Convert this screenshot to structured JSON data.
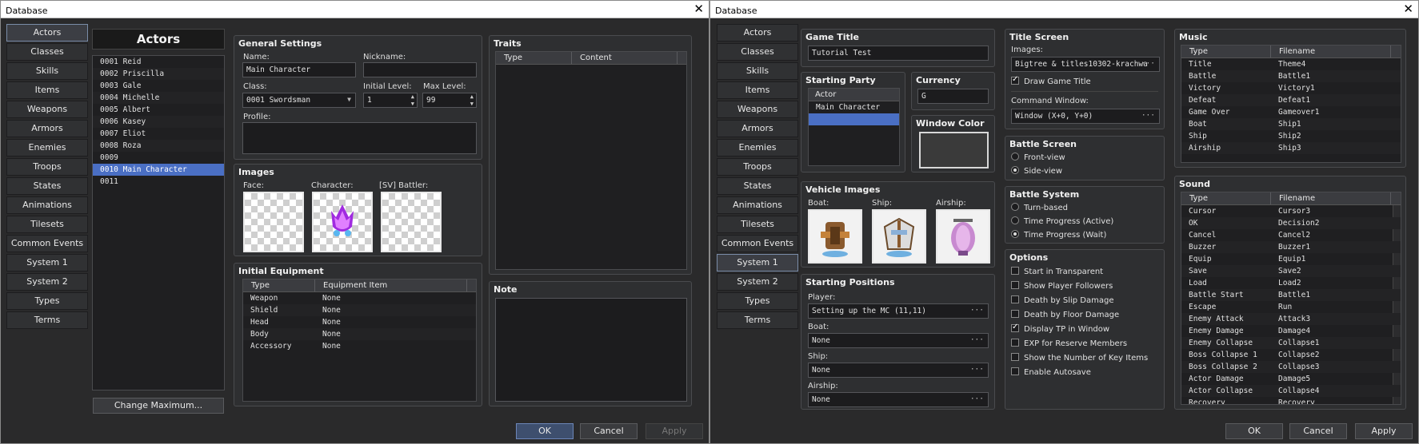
{
  "left": {
    "window_title": "Database",
    "tabs": [
      "Actors",
      "Classes",
      "Skills",
      "Items",
      "Weapons",
      "Armors",
      "Enemies",
      "Troops",
      "States",
      "Animations",
      "Tilesets",
      "Common Events",
      "System 1",
      "System 2",
      "Types",
      "Terms"
    ],
    "list_title": "Actors",
    "actors": [
      "0001 Reid",
      "0002 Priscilla",
      "0003 Gale",
      "0004 Michelle",
      "0005 Albert",
      "0006 Kasey",
      "0007 Eliot",
      "0008 Roza",
      "0009",
      "0010 Main Character",
      "0011"
    ],
    "change_max": "Change Maximum...",
    "general": {
      "title": "General Settings",
      "name_label": "Name:",
      "name_value": "Main Character",
      "nick_label": "Nickname:",
      "nick_value": "",
      "class_label": "Class:",
      "class_value": "0001 Swordsman",
      "init_label": "Initial Level:",
      "init_value": "1",
      "max_label": "Max Level:",
      "max_value": "99",
      "profile_label": "Profile:"
    },
    "images": {
      "title": "Images",
      "face": "Face:",
      "character": "Character:",
      "battler": "[SV] Battler:"
    },
    "equipment": {
      "title": "Initial Equipment",
      "col_type": "Type",
      "col_item": "Equipment Item",
      "rows": [
        [
          "Weapon",
          "None"
        ],
        [
          "Shield",
          "None"
        ],
        [
          "Head",
          "None"
        ],
        [
          "Body",
          "None"
        ],
        [
          "Accessory",
          "None"
        ]
      ]
    },
    "traits": {
      "title": "Traits",
      "col_type": "Type",
      "col_content": "Content"
    },
    "note": {
      "title": "Note"
    },
    "buttons": {
      "ok": "OK",
      "cancel": "Cancel",
      "apply": "Apply"
    }
  },
  "right": {
    "window_title": "Database",
    "tabs": [
      "Actors",
      "Classes",
      "Skills",
      "Items",
      "Weapons",
      "Armors",
      "Enemies",
      "Troops",
      "States",
      "Animations",
      "Tilesets",
      "Common Events",
      "System 1",
      "System 2",
      "Types",
      "Terms"
    ],
    "game_title": {
      "title": "Game Title",
      "value": "Tutorial Test"
    },
    "party": {
      "title": "Starting Party",
      "header": "Actor",
      "rows": [
        "Main Character"
      ]
    },
    "currency": {
      "title": "Currency",
      "value": "G"
    },
    "window_color": {
      "title": "Window Color"
    },
    "vehicle": {
      "title": "Vehicle Images",
      "boat": "Boat:",
      "ship": "Ship:",
      "airship": "Airship:"
    },
    "positions": {
      "title": "Starting Positions",
      "player_label": "Player:",
      "player_value": "Setting up the MC (11,11)",
      "boat_label": "Boat:",
      "boat_value": "None",
      "ship_label": "Ship:",
      "ship_value": "None",
      "airship_label": "Airship:",
      "airship_value": "None"
    },
    "title_screen": {
      "title": "Title Screen",
      "images_label": "Images:",
      "images_value": "Bigtree & titles10302-krachwa",
      "draw_title": "Draw Game Title",
      "cmd_label": "Command Window:",
      "cmd_value": "Window (X+0, Y+0)"
    },
    "battle_screen": {
      "title": "Battle Screen",
      "front": "Front-view",
      "side": "Side-view"
    },
    "battle_system": {
      "title": "Battle System",
      "opts": [
        "Turn-based",
        "Time Progress (Active)",
        "Time Progress (Wait)"
      ]
    },
    "options": {
      "title": "Options",
      "items": [
        "Start in Transparent",
        "Show Player Followers",
        "Death by Slip Damage",
        "Death by Floor Damage",
        "Display TP in Window",
        "EXP for Reserve Members",
        "Show the Number of Key Items",
        "Enable Autosave"
      ]
    },
    "music": {
      "title": "Music",
      "col_type": "Type",
      "col_file": "Filename",
      "rows": [
        [
          "Title",
          "Theme4"
        ],
        [
          "Battle",
          "Battle1"
        ],
        [
          "Victory",
          "Victory1"
        ],
        [
          "Defeat",
          "Defeat1"
        ],
        [
          "Game Over",
          "Gameover1"
        ],
        [
          "Boat",
          "Ship1"
        ],
        [
          "Ship",
          "Ship2"
        ],
        [
          "Airship",
          "Ship3"
        ]
      ]
    },
    "sound": {
      "title": "Sound",
      "col_type": "Type",
      "col_file": "Filename",
      "rows": [
        [
          "Cursor",
          "Cursor3"
        ],
        [
          "OK",
          "Decision2"
        ],
        [
          "Cancel",
          "Cancel2"
        ],
        [
          "Buzzer",
          "Buzzer1"
        ],
        [
          "Equip",
          "Equip1"
        ],
        [
          "Save",
          "Save2"
        ],
        [
          "Load",
          "Load2"
        ],
        [
          "Battle Start",
          "Battle1"
        ],
        [
          "Escape",
          "Run"
        ],
        [
          "Enemy Attack",
          "Attack3"
        ],
        [
          "Enemy Damage",
          "Damage4"
        ],
        [
          "Enemy Collapse",
          "Collapse1"
        ],
        [
          "Boss Collapse 1",
          "Collapse2"
        ],
        [
          "Boss Collapse 2",
          "Collapse3"
        ],
        [
          "Actor Damage",
          "Damage5"
        ],
        [
          "Actor Collapse",
          "Collapse4"
        ],
        [
          "Recovery",
          "Recovery"
        ]
      ]
    },
    "buttons": {
      "ok": "OK",
      "cancel": "Cancel",
      "apply": "Apply"
    }
  }
}
